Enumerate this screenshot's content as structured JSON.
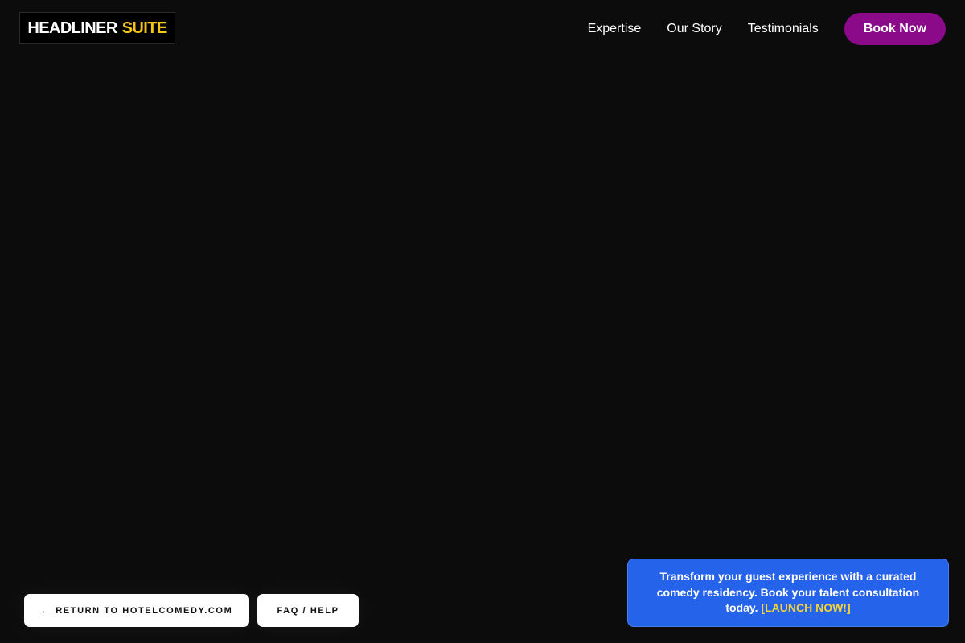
{
  "header": {
    "logo": {
      "main": "HEADLINER",
      "accent": "SUITE"
    },
    "nav": [
      {
        "label": "Expertise"
      },
      {
        "label": "Our Story"
      },
      {
        "label": "Testimonials"
      }
    ],
    "book_label": "Book Now"
  },
  "footer_buttons": {
    "return_arrow": "←",
    "return_label": "RETURN TO HOTELCOMEDY.COM",
    "faq_label": "FAQ / HELP"
  },
  "promo": {
    "text": "Transform your guest experience with a curated comedy residency. Book your talent consultation today.",
    "cta": "[LAUNCH NOW!]"
  },
  "colors": {
    "background": "#0c0c0c",
    "logo_accent": "#f5c518",
    "book_button": "#8a0a8a",
    "promo_background": "#2563eb",
    "promo_cta": "#f5d33a"
  },
  "icons": {
    "return": "left-arrow-icon"
  }
}
